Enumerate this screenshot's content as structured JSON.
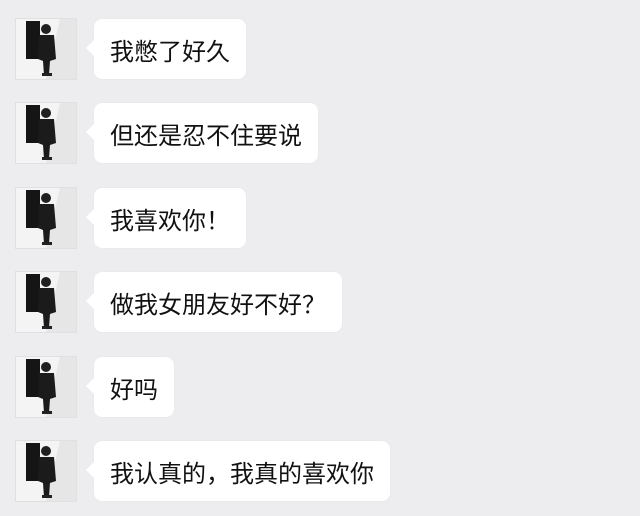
{
  "chat": {
    "messages": [
      {
        "text": "我憋了好久",
        "avatar_icon": "user-avatar-icon"
      },
      {
        "text": "但还是忍不住要说",
        "avatar_icon": "user-avatar-icon"
      },
      {
        "text": "我喜欢你！",
        "avatar_icon": "user-avatar-icon"
      },
      {
        "text": "做我女朋友好不好？",
        "avatar_icon": "user-avatar-icon"
      },
      {
        "text": "好吗",
        "avatar_icon": "user-avatar-icon"
      },
      {
        "text": "我认真的，我真的喜欢你",
        "avatar_icon": "user-avatar-icon"
      }
    ]
  },
  "colors": {
    "background": "#edecef",
    "bubble": "#ffffff",
    "text": "#111111"
  }
}
